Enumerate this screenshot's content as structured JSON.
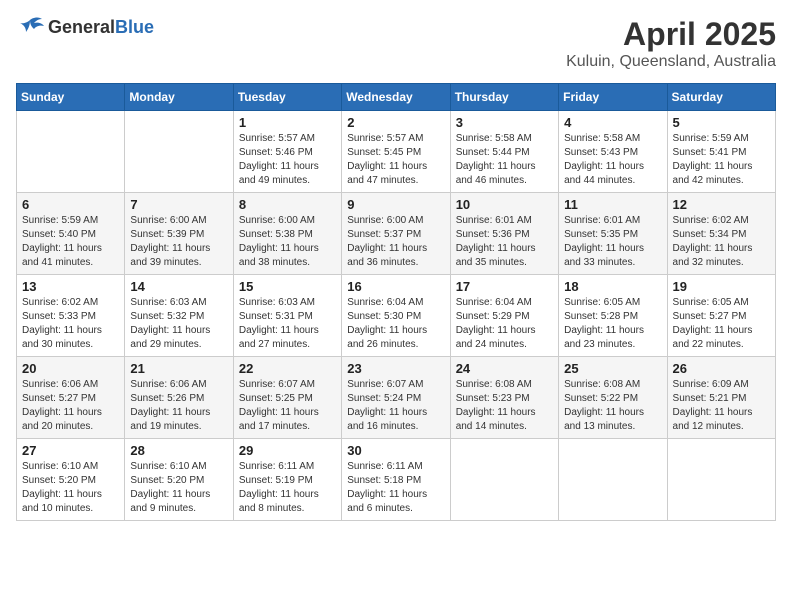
{
  "header": {
    "logo_general": "General",
    "logo_blue": "Blue",
    "month": "April 2025",
    "location": "Kuluin, Queensland, Australia"
  },
  "calendar": {
    "days_of_week": [
      "Sunday",
      "Monday",
      "Tuesday",
      "Wednesday",
      "Thursday",
      "Friday",
      "Saturday"
    ],
    "weeks": [
      [
        {
          "day": "",
          "info": ""
        },
        {
          "day": "",
          "info": ""
        },
        {
          "day": "1",
          "info": "Sunrise: 5:57 AM\nSunset: 5:46 PM\nDaylight: 11 hours and 49 minutes."
        },
        {
          "day": "2",
          "info": "Sunrise: 5:57 AM\nSunset: 5:45 PM\nDaylight: 11 hours and 47 minutes."
        },
        {
          "day": "3",
          "info": "Sunrise: 5:58 AM\nSunset: 5:44 PM\nDaylight: 11 hours and 46 minutes."
        },
        {
          "day": "4",
          "info": "Sunrise: 5:58 AM\nSunset: 5:43 PM\nDaylight: 11 hours and 44 minutes."
        },
        {
          "day": "5",
          "info": "Sunrise: 5:59 AM\nSunset: 5:41 PM\nDaylight: 11 hours and 42 minutes."
        }
      ],
      [
        {
          "day": "6",
          "info": "Sunrise: 5:59 AM\nSunset: 5:40 PM\nDaylight: 11 hours and 41 minutes."
        },
        {
          "day": "7",
          "info": "Sunrise: 6:00 AM\nSunset: 5:39 PM\nDaylight: 11 hours and 39 minutes."
        },
        {
          "day": "8",
          "info": "Sunrise: 6:00 AM\nSunset: 5:38 PM\nDaylight: 11 hours and 38 minutes."
        },
        {
          "day": "9",
          "info": "Sunrise: 6:00 AM\nSunset: 5:37 PM\nDaylight: 11 hours and 36 minutes."
        },
        {
          "day": "10",
          "info": "Sunrise: 6:01 AM\nSunset: 5:36 PM\nDaylight: 11 hours and 35 minutes."
        },
        {
          "day": "11",
          "info": "Sunrise: 6:01 AM\nSunset: 5:35 PM\nDaylight: 11 hours and 33 minutes."
        },
        {
          "day": "12",
          "info": "Sunrise: 6:02 AM\nSunset: 5:34 PM\nDaylight: 11 hours and 32 minutes."
        }
      ],
      [
        {
          "day": "13",
          "info": "Sunrise: 6:02 AM\nSunset: 5:33 PM\nDaylight: 11 hours and 30 minutes."
        },
        {
          "day": "14",
          "info": "Sunrise: 6:03 AM\nSunset: 5:32 PM\nDaylight: 11 hours and 29 minutes."
        },
        {
          "day": "15",
          "info": "Sunrise: 6:03 AM\nSunset: 5:31 PM\nDaylight: 11 hours and 27 minutes."
        },
        {
          "day": "16",
          "info": "Sunrise: 6:04 AM\nSunset: 5:30 PM\nDaylight: 11 hours and 26 minutes."
        },
        {
          "day": "17",
          "info": "Sunrise: 6:04 AM\nSunset: 5:29 PM\nDaylight: 11 hours and 24 minutes."
        },
        {
          "day": "18",
          "info": "Sunrise: 6:05 AM\nSunset: 5:28 PM\nDaylight: 11 hours and 23 minutes."
        },
        {
          "day": "19",
          "info": "Sunrise: 6:05 AM\nSunset: 5:27 PM\nDaylight: 11 hours and 22 minutes."
        }
      ],
      [
        {
          "day": "20",
          "info": "Sunrise: 6:06 AM\nSunset: 5:27 PM\nDaylight: 11 hours and 20 minutes."
        },
        {
          "day": "21",
          "info": "Sunrise: 6:06 AM\nSunset: 5:26 PM\nDaylight: 11 hours and 19 minutes."
        },
        {
          "day": "22",
          "info": "Sunrise: 6:07 AM\nSunset: 5:25 PM\nDaylight: 11 hours and 17 minutes."
        },
        {
          "day": "23",
          "info": "Sunrise: 6:07 AM\nSunset: 5:24 PM\nDaylight: 11 hours and 16 minutes."
        },
        {
          "day": "24",
          "info": "Sunrise: 6:08 AM\nSunset: 5:23 PM\nDaylight: 11 hours and 14 minutes."
        },
        {
          "day": "25",
          "info": "Sunrise: 6:08 AM\nSunset: 5:22 PM\nDaylight: 11 hours and 13 minutes."
        },
        {
          "day": "26",
          "info": "Sunrise: 6:09 AM\nSunset: 5:21 PM\nDaylight: 11 hours and 12 minutes."
        }
      ],
      [
        {
          "day": "27",
          "info": "Sunrise: 6:10 AM\nSunset: 5:20 PM\nDaylight: 11 hours and 10 minutes."
        },
        {
          "day": "28",
          "info": "Sunrise: 6:10 AM\nSunset: 5:20 PM\nDaylight: 11 hours and 9 minutes."
        },
        {
          "day": "29",
          "info": "Sunrise: 6:11 AM\nSunset: 5:19 PM\nDaylight: 11 hours and 8 minutes."
        },
        {
          "day": "30",
          "info": "Sunrise: 6:11 AM\nSunset: 5:18 PM\nDaylight: 11 hours and 6 minutes."
        },
        {
          "day": "",
          "info": ""
        },
        {
          "day": "",
          "info": ""
        },
        {
          "day": "",
          "info": ""
        }
      ]
    ]
  }
}
